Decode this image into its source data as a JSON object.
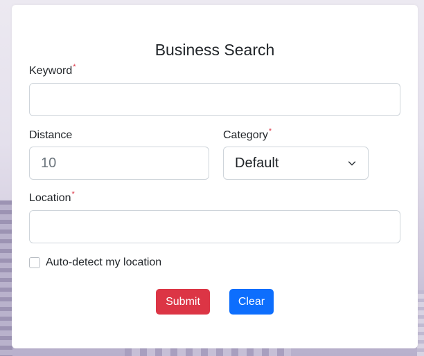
{
  "form": {
    "title": "Business Search",
    "keyword": {
      "label": "Keyword",
      "required_mark": "*",
      "value": "",
      "placeholder": ""
    },
    "distance": {
      "label": "Distance",
      "placeholder": "10",
      "value": ""
    },
    "category": {
      "label": "Category",
      "required_mark": "*",
      "selected": "Default"
    },
    "location": {
      "label": "Location",
      "required_mark": "*",
      "value": "",
      "placeholder": ""
    },
    "auto_detect": {
      "label": "Auto-detect my location",
      "checked": false
    },
    "buttons": {
      "submit_label": "Submit",
      "clear_label": "Clear"
    }
  },
  "colors": {
    "submit": "#dc3545",
    "clear": "#0d6efd",
    "required": "#dc3545"
  },
  "icons": {
    "category_dropdown": "chevron-down-icon"
  }
}
